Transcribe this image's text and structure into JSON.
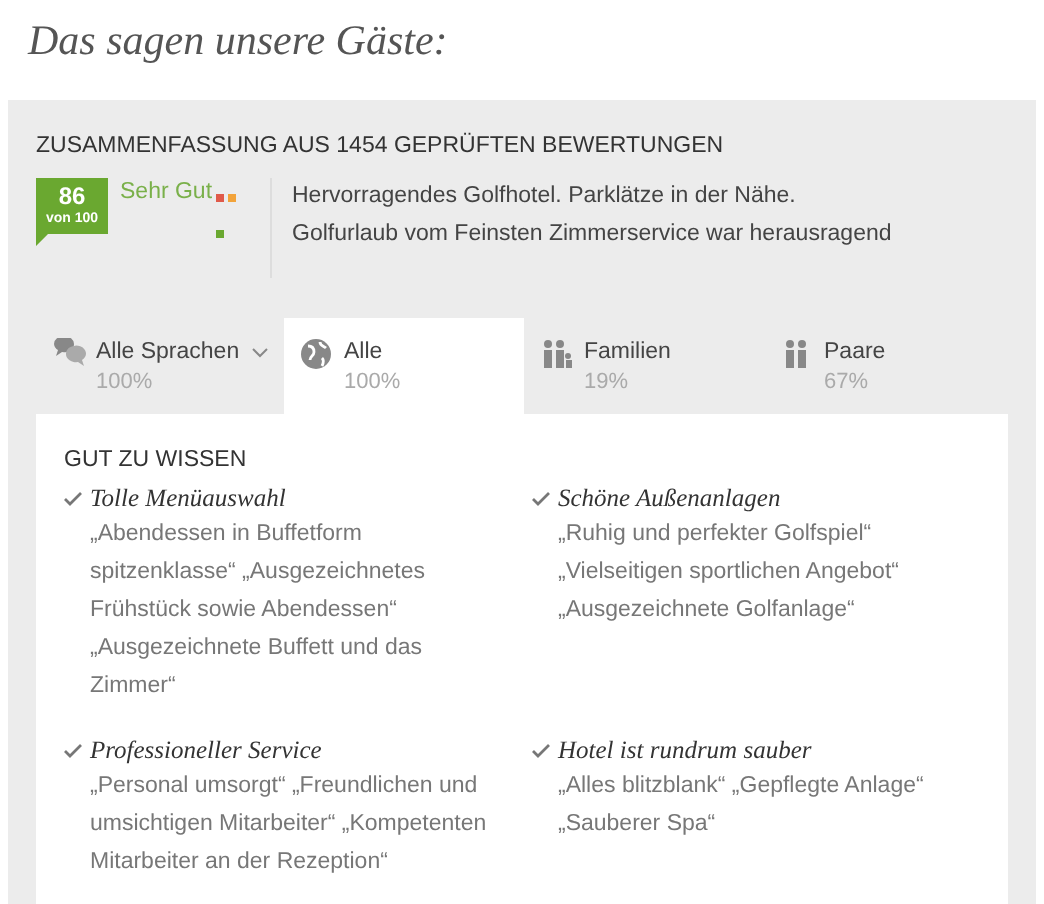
{
  "heading": "Das sagen unsere Gäste:",
  "summary": {
    "title": "ZUSAMMENFASSUNG AUS 1454 GEPRÜFTEN BEWERTUNGEN",
    "score": "86",
    "score_scale": "von 100",
    "rating": "Sehr Gut",
    "highlights": [
      "Hervorragendes Golfhotel. Parklätze in der Nähe.",
      "Golfurlaub vom Feinsten Zimmerservice war herausragend"
    ]
  },
  "tabs": [
    {
      "kind": "language",
      "label": "Alle Sprachen",
      "percent": "100%",
      "selected": false
    },
    {
      "kind": "globe",
      "label": "Alle",
      "percent": "100%",
      "selected": true
    },
    {
      "kind": "family",
      "label": "Familien",
      "percent": "19%",
      "selected": false
    },
    {
      "kind": "couple",
      "label": "Paare",
      "percent": "67%",
      "selected": false
    }
  ],
  "good_to_know": {
    "title": "GUT ZU WISSEN",
    "items": [
      {
        "title": "Tolle Menüauswahl",
        "quotes": "„Abendessen in Buffetform spitzenklasse“ „Ausgezeichnetes Frühstück sowie Abendessen“ „Ausgezeichnete Buffett und das Zimmer“"
      },
      {
        "title": "Schöne Außenanlagen",
        "quotes": "„Ruhig und perfekter Golfspiel“ „Vielseitigen sportlichen Angebot“ „Ausgezeichnete Golfanlage“"
      },
      {
        "title": "Professioneller Service",
        "quotes": "„Personal umsorgt“ „Freundlichen und umsichtigen Mitarbeiter“ „Kompetenten Mitarbeiter an der Rezeption“"
      },
      {
        "title": "Hotel ist rundrum sauber",
        "quotes": "„Alles blitzblank“ „Gepflegte Anlage“ „Sauberer Spa“"
      }
    ]
  }
}
